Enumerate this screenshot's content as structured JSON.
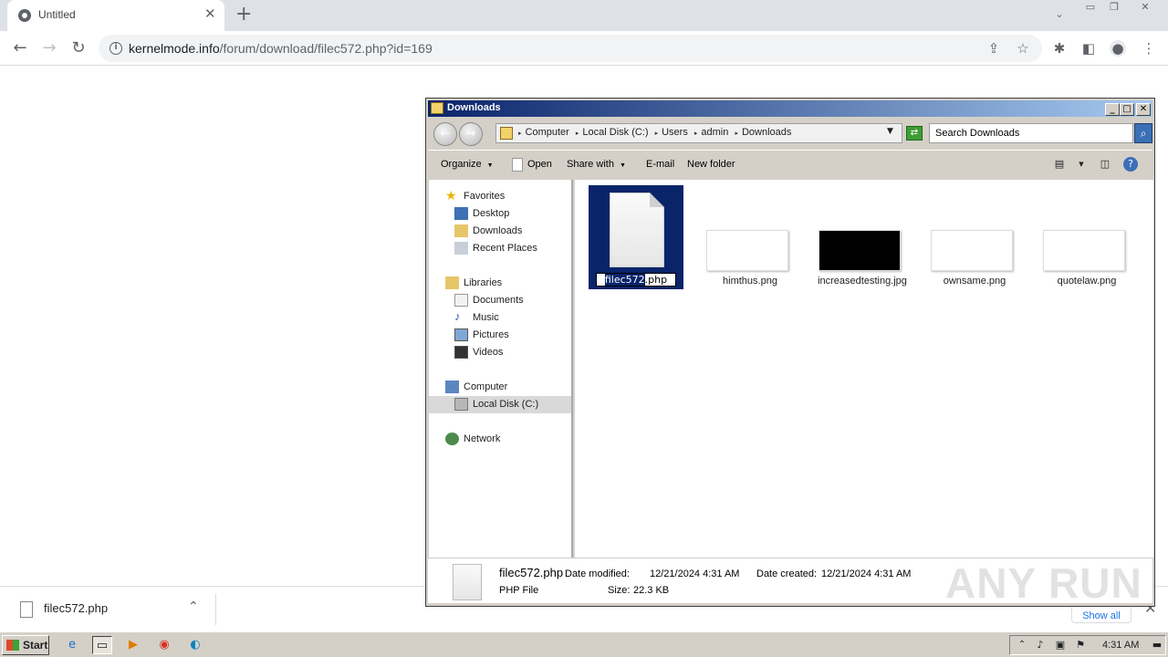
{
  "browser": {
    "tab_title": "Untitled",
    "url_domain": "kernelmode.info",
    "url_path": "/forum/download/filec572.php?id=169"
  },
  "download_bar": {
    "filename": "filec572.php",
    "show_all": "Show all"
  },
  "explorer": {
    "title": "Downloads",
    "breadcrumbs": [
      "Computer",
      "Local Disk (C:)",
      "Users",
      "admin",
      "Downloads"
    ],
    "search_placeholder": "Search Downloads",
    "commands": {
      "organize": "Organize",
      "open": "Open",
      "share_with": "Share with",
      "email": "E-mail",
      "new_folder": "New folder"
    },
    "nav": {
      "favorites": "Favorites",
      "desktop": "Desktop",
      "downloads": "Downloads",
      "recent": "Recent Places",
      "libraries": "Libraries",
      "documents": "Documents",
      "music": "Music",
      "pictures": "Pictures",
      "videos": "Videos",
      "computer": "Computer",
      "local_disk": "Local Disk (C:)",
      "network": "Network"
    },
    "files": {
      "selected_rename_highlight": "filec572",
      "selected_rename_rest": ".php",
      "f2": "himthus.png",
      "f3": "increasedtesting.jpg",
      "f4": "ownsame.png",
      "f5": "quotelaw.png"
    },
    "details": {
      "name": "filec572.php",
      "type": "PHP File",
      "modified_label": "Date modified:",
      "modified": "12/21/2024 4:31 AM",
      "size_label": "Size:",
      "size": "22.3 KB",
      "created_label": "Date created:",
      "created": "12/21/2024 4:31 AM"
    }
  },
  "taskbar": {
    "start": "Start",
    "clock": "4:31 AM"
  },
  "watermark": "ANY RUN"
}
